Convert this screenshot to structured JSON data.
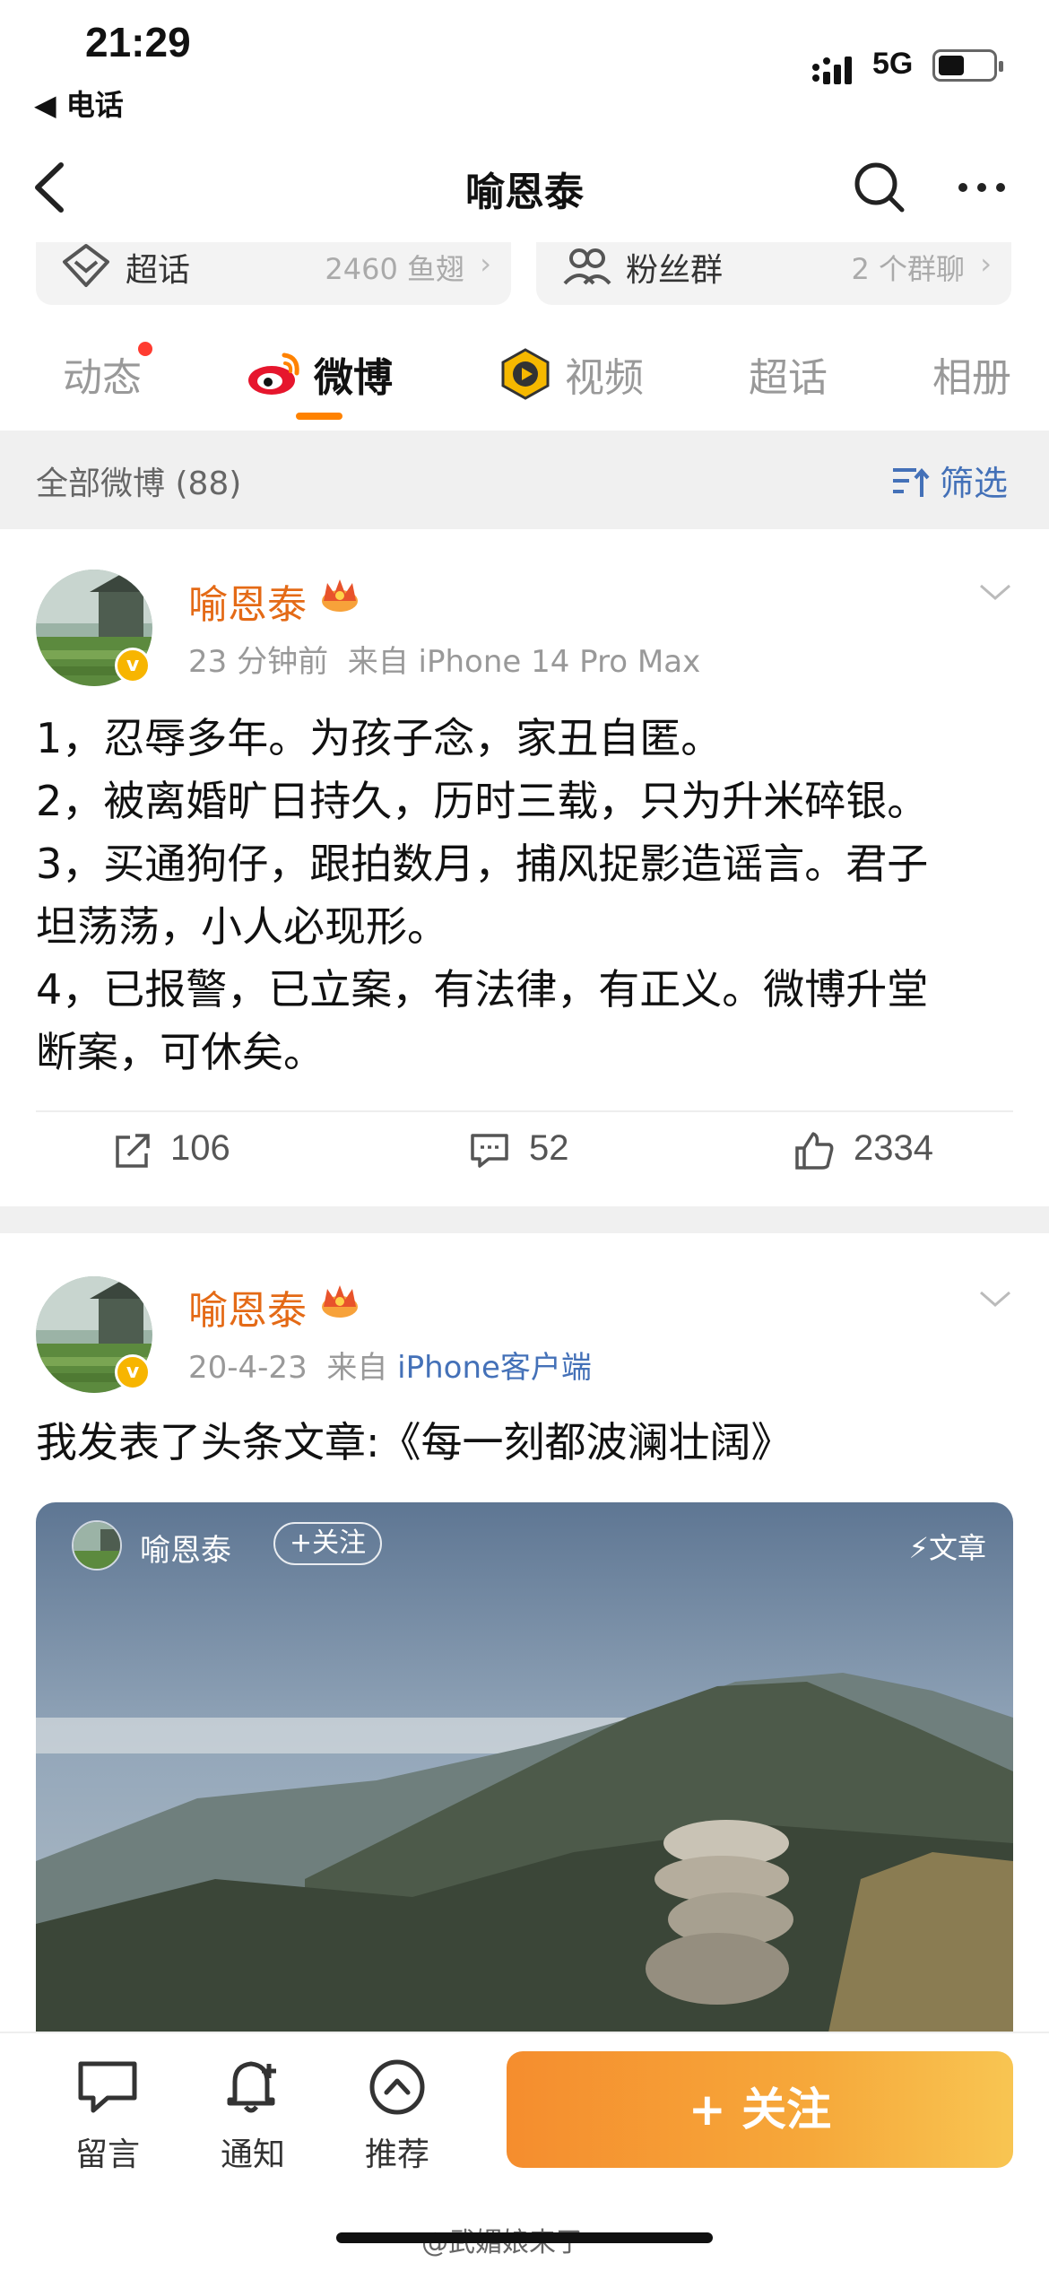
{
  "status_bar": {
    "time": "21:29",
    "back_app": "◀ 电话",
    "network": "5G"
  },
  "nav": {
    "title": "喻恩泰"
  },
  "cards": {
    "left": {
      "label": "超话",
      "value": "2460 鱼翅"
    },
    "right": {
      "label": "粉丝群",
      "value": "2 个群聊"
    }
  },
  "tabs": [
    {
      "label": "动态",
      "has_dot": true
    },
    {
      "label": "微博",
      "active": true
    },
    {
      "label": "视频"
    },
    {
      "label": "超话"
    },
    {
      "label": "相册"
    }
  ],
  "filter": {
    "label": "全部微博 (88)",
    "button": "筛选"
  },
  "posts": [
    {
      "author": "喻恩泰",
      "time": "23 分钟前",
      "source_prefix": "来自",
      "source": "iPhone 14 Pro Max",
      "lines": [
        "1，忍辱多年。为孩子念，家丑自匿。",
        "2，被离婚旷日持久，历时三载，只为升米碎银。",
        "3，买通狗仔，跟拍数月，捕风捉影造谣言。君子",
        "坦荡荡，小人必现形。",
        "4，已报警，已立案，有法律，有正义。微博升堂",
        "断案，可休矣。"
      ],
      "reposts": "106",
      "comments": "52",
      "likes": "2334"
    },
    {
      "author": "喻恩泰",
      "time": "20-4-23",
      "source_prefix": "来自",
      "source": "iPhone客户端",
      "text": "我发表了头条文章:《每一刻都波澜壮阔》",
      "article": {
        "author": "喻恩泰",
        "follow": "+关注",
        "tag": "文章"
      }
    }
  ],
  "bottom_bar": {
    "items": [
      {
        "label": "留言",
        "icon": "message-icon"
      },
      {
        "label": "通知",
        "icon": "bell-plus-icon"
      },
      {
        "label": "推荐",
        "icon": "chevron-up-circle-icon"
      }
    ],
    "follow_button": "+ 关注",
    "watermark": "@武媚娘来了"
  },
  "colors": {
    "accent_orange": "#ff8200",
    "author_orange": "#e46a16",
    "link_blue": "#4471b8"
  }
}
